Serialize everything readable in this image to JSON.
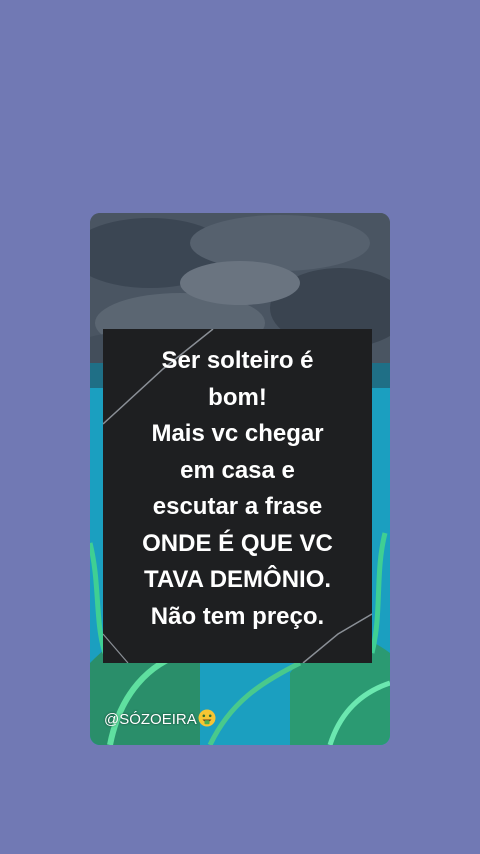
{
  "post": {
    "quote_lines": [
      "Ser solteiro é",
      "bom!",
      "Mais vc chegar",
      "em casa e",
      "escutar a frase",
      "ONDE É QUE VC",
      "TAVA DEMÔNIO.",
      "Não tem preço."
    ],
    "watermark_handle": "@SÓZOEIRA",
    "watermark_emoji": "money-mouth-face-icon"
  },
  "colors": {
    "background": "#7179b4",
    "text_box": "#1e1f21",
    "text": "#ffffff",
    "water": "#1fa3c4"
  }
}
